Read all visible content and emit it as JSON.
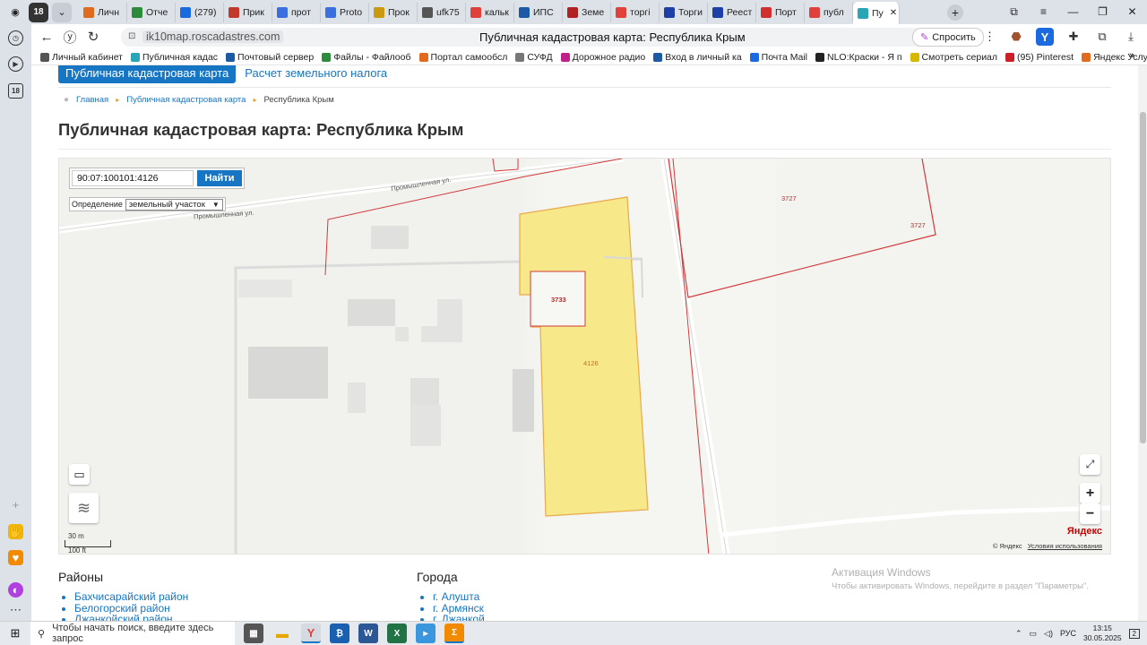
{
  "browser": {
    "tab_count_badge": "18",
    "tabs": [
      {
        "label": "Личн",
        "color": "#e06b1e"
      },
      {
        "label": "Отче",
        "color": "#2d8c3c"
      },
      {
        "label": "(279)",
        "color": "#1b6ae0"
      },
      {
        "label": "Прик",
        "color": "#c0392b"
      },
      {
        "label": "прот",
        "color": "#3b6fe0"
      },
      {
        "label": "Proto",
        "color": "#3b6fe0"
      },
      {
        "label": "Прок",
        "color": "#c99a10"
      },
      {
        "label": "ufk75",
        "color": "#555555"
      },
      {
        "label": "кальк",
        "color": "#e0413a"
      },
      {
        "label": "ИПС",
        "color": "#1d5aa6"
      },
      {
        "label": "Земе",
        "color": "#b32020"
      },
      {
        "label": "торгі",
        "color": "#e0413a"
      },
      {
        "label": "Торги",
        "color": "#1d3fa6"
      },
      {
        "label": "Реест",
        "color": "#1d3fa6"
      },
      {
        "label": "Порт",
        "color": "#d03030"
      },
      {
        "label": "публ",
        "color": "#e0413a"
      },
      {
        "label": "Пу",
        "color": "#2aa5b5",
        "active": true
      }
    ],
    "url": "ik10map.roscadastres.com",
    "page_title": "Публичная кадастровая карта: Республика Крым",
    "ask_label": "Спросить",
    "bookmarks": [
      {
        "label": "Личный кабинет",
        "color": "#555555"
      },
      {
        "label": "Публичная кадас",
        "color": "#2aa5b5"
      },
      {
        "label": "Почтовый сервер",
        "color": "#1d5aa6"
      },
      {
        "label": "Файлы - Файлооб",
        "color": "#2d8c3c"
      },
      {
        "label": "Портал самообсл",
        "color": "#e06b1e"
      },
      {
        "label": "СУФД",
        "color": "#777777"
      },
      {
        "label": "Дорожное радио",
        "color": "#c0208c"
      },
      {
        "label": "Вход в личный ка",
        "color": "#1d5aa6"
      },
      {
        "label": "Почта Mail",
        "color": "#1b6ae0"
      },
      {
        "label": "NLO:Краски - Я п",
        "color": "#222222"
      },
      {
        "label": "Смотреть сериал",
        "color": "#d6b800"
      },
      {
        "label": "(95) Pinterest",
        "color": "#cc1f27"
      },
      {
        "label": "Яндекс Услуг",
        "color": "#e06b1e"
      }
    ]
  },
  "page": {
    "nav_active": "Публичная кадастровая карта",
    "nav_link": "Расчет земельного налога",
    "breadcrumb": [
      "Главная",
      "Публичная кадастровая карта",
      "Республика Крым"
    ],
    "heading": "Публичная кадастровая карта: Республика Крым"
  },
  "map": {
    "search_value": "90:07:100101:4126",
    "search_button": "Найти",
    "definition_label": "Определение",
    "definition_value": "земельный участок",
    "street_labels": [
      "Промышленная ул.",
      "Промышленная ул."
    ],
    "parcel_labels": [
      "3727",
      "3727",
      "3733",
      "4126"
    ],
    "scale_top": "30 m",
    "scale_bottom": "100 ft",
    "logo": "Яндекс",
    "copyright": "© Яндекс",
    "terms": "Условия использования",
    "colors": {
      "highlight_fill": "#f7e98a",
      "highlight_stroke": "#e8a94a",
      "parcel_stroke": "#d03a3a"
    }
  },
  "sections": {
    "districts_title": "Районы",
    "districts": [
      "Бахчисарайский район",
      "Белогорский район",
      "Джанкойский район"
    ],
    "cities_title": "Города",
    "cities": [
      "г. Алушта",
      "г. Армянск",
      "г. Джанкой"
    ]
  },
  "activation": {
    "title": "Активация Windows",
    "text": "Чтобы активировать Windows, перейдите в раздел \"Параметры\"."
  },
  "taskbar": {
    "search_placeholder": "Чтобы начать поиск, введите здесь запрос",
    "lang": "РУС",
    "time": "13:15",
    "date": "30.05.2025",
    "notifications": "2"
  }
}
